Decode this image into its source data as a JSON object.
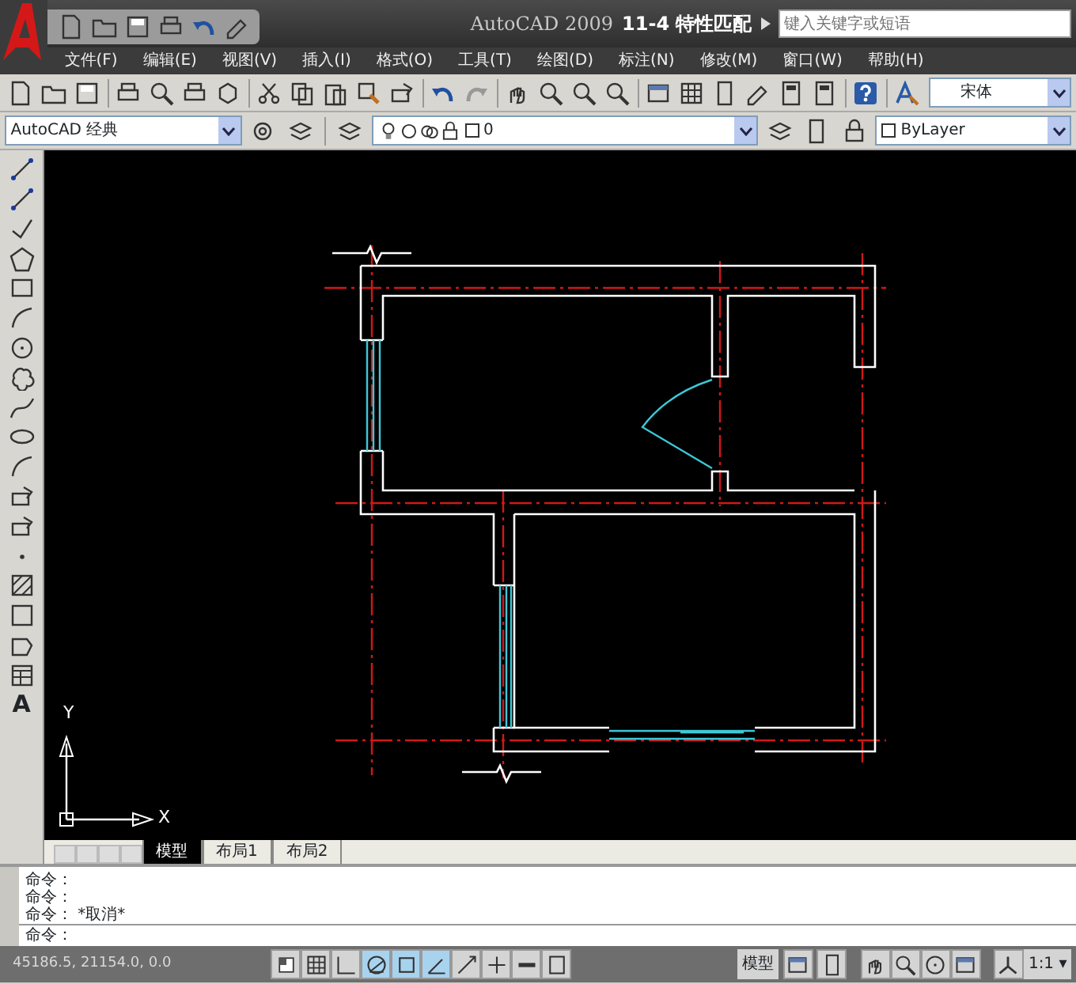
{
  "title_bar": {
    "app_title": "AutoCAD 2009",
    "document_title": "11-4 特性匹配",
    "search": {
      "placeholder": "键入关键字或短语"
    }
  },
  "menu": [
    "文件(F)",
    "编辑(E)",
    "视图(V)",
    "插入(I)",
    "格式(O)",
    "工具(T)",
    "绘图(D)",
    "标注(N)",
    "修改(M)",
    "窗口(W)",
    "帮助(H)"
  ],
  "standard_toolbar": {
    "font": "宋体"
  },
  "layers_toolbar": {
    "workspace": "AutoCAD 经典",
    "layer": "0",
    "color_control": "ByLayer"
  },
  "draw_toolbar": {
    "text_tool": "A"
  },
  "canvas": {
    "ucs": {
      "x_label": "X",
      "y_label": "Y"
    }
  },
  "layout_tabs": [
    {
      "label": "模型",
      "selected": true
    },
    {
      "label": "布局1",
      "selected": false
    },
    {
      "label": "布局2",
      "selected": false
    }
  ],
  "command_history": [
    "命令：",
    "命令：",
    "命令： *取消*"
  ],
  "command_prompt": "命令：",
  "status_bar": {
    "coordinates": {
      "text": "45186.5, 21154.0, 0.0",
      "disabled": true
    },
    "toggles": [
      {
        "kind": "snap",
        "on": false
      },
      {
        "kind": "grid",
        "on": false
      },
      {
        "kind": "ortho",
        "on": false
      },
      {
        "kind": "polar",
        "on": true
      },
      {
        "kind": "osnap",
        "on": true
      },
      {
        "kind": "otrack",
        "on": true
      },
      {
        "kind": "ducs",
        "on": false
      },
      {
        "kind": "dyn",
        "on": false
      },
      {
        "kind": "lwt",
        "on": false
      },
      {
        "kind": "qp",
        "on": false
      }
    ],
    "space": "模型",
    "scale": "1:1 ▾"
  }
}
